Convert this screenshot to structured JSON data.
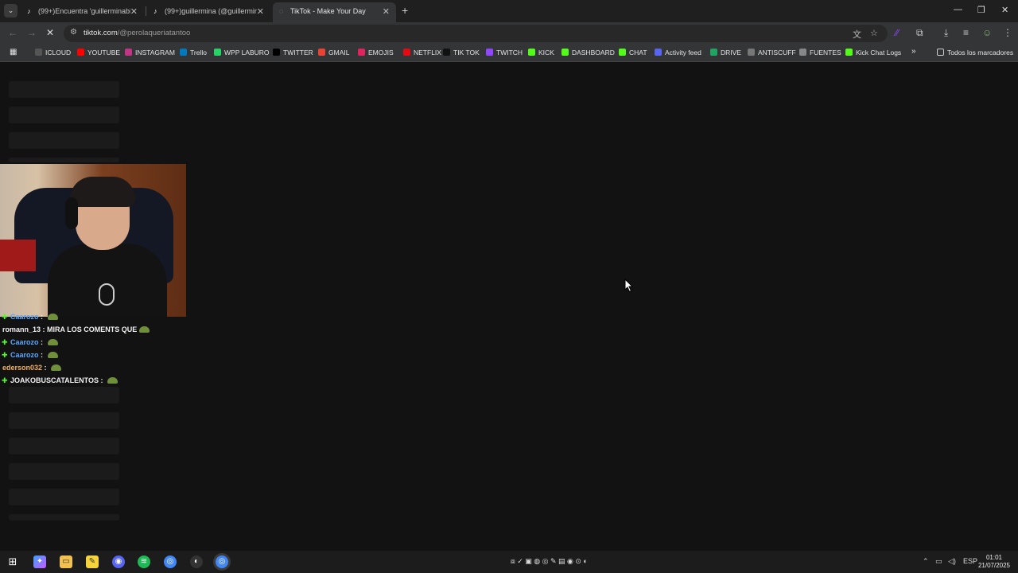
{
  "tabs": [
    {
      "title": "(99+)Encuentra 'guillerminabiar",
      "active": false
    },
    {
      "title": "(99+)guillermina (@guillermina",
      "active": false
    },
    {
      "title": "TikTok - Make Your Day",
      "active": true
    }
  ],
  "new_tab_label": "+",
  "address": {
    "host": "tiktok.com",
    "path": "/@perolaqueriatantoo"
  },
  "bookmarks": [
    {
      "label": "ICLOUD",
      "color": "#555555",
      "icon": "apple-icon"
    },
    {
      "label": "YOUTUBE",
      "color": "#ff0000",
      "icon": "youtube-icon"
    },
    {
      "label": "INSTAGRAM",
      "color": "#c13584",
      "icon": "instagram-icon"
    },
    {
      "label": "Trello",
      "color": "#0079bf",
      "icon": "trello-icon"
    },
    {
      "label": "WPP LABURO",
      "color": "#25d366",
      "icon": "whatsapp-icon"
    },
    {
      "label": "TWITTER",
      "color": "#000000",
      "icon": "x-icon"
    },
    {
      "label": "GMAIL",
      "color": "#ea4335",
      "icon": "gmail-icon"
    },
    {
      "label": "EMOJIS",
      "color": "#e0245e",
      "icon": "emoji-icon"
    },
    {
      "label": "NETFLIX",
      "color": "#e50914",
      "icon": "netflix-icon"
    },
    {
      "label": "TIK TOK",
      "color": "#111111",
      "icon": "tiktok-icon"
    },
    {
      "label": "TWITCH",
      "color": "#9146ff",
      "icon": "twitch-icon"
    },
    {
      "label": "KICK",
      "color": "#53fc18",
      "icon": "kick-icon"
    },
    {
      "label": "DASHBOARD",
      "color": "#53fc18",
      "icon": "kick-icon"
    },
    {
      "label": "CHAT",
      "color": "#53fc18",
      "icon": "kick-icon"
    },
    {
      "label": "Activity feed",
      "color": "#5865f2",
      "icon": "activity-icon"
    },
    {
      "label": "DRIVE",
      "color": "#1fa463",
      "icon": "drive-icon"
    },
    {
      "label": "ANTISCUFF",
      "color": "#777777",
      "icon": "bars-icon"
    },
    {
      "label": "FUENTES",
      "color": "#888888",
      "icon": "globe-icon"
    },
    {
      "label": "Kick Chat Logs",
      "color": "#53fc18",
      "icon": "kick-icon"
    }
  ],
  "bookmarks_more": "»",
  "all_bookmarks": "Todos los marcadores",
  "chat": [
    {
      "user": "Caarozo",
      "msg": "",
      "badge": true,
      "user_color": "blue"
    },
    {
      "user": "romann_13",
      "msg": "MIRA LOS COMENTS QUE",
      "badge": false,
      "user_color": "white"
    },
    {
      "user": "Caarozo",
      "msg": "",
      "badge": true,
      "user_color": "blue"
    },
    {
      "user": "Caarozo",
      "msg": "",
      "badge": true,
      "user_color": "blue"
    },
    {
      "user": "ederson032",
      "msg": "",
      "badge": false,
      "user_color": "orange"
    },
    {
      "user": "JOAKOBUSCATALENTOS",
      "msg": "",
      "badge": true,
      "user_color": "white"
    }
  ],
  "taskbar": {
    "lang": "ESP",
    "time": "01:01",
    "date": "21/07/2025"
  }
}
